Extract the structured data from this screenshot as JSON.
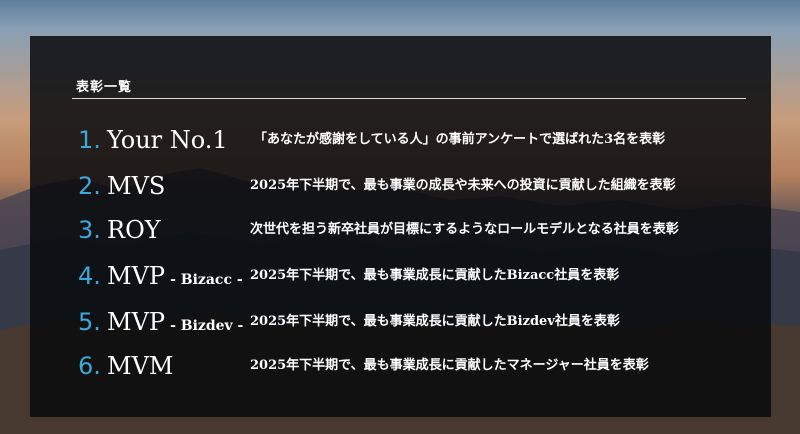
{
  "section": {
    "title": "表彰一覧"
  },
  "awards": [
    {
      "num": "1.",
      "name": "Your No.1",
      "sub": "",
      "desc": "「あなたが感謝をしている人」の事前アンケートで選ばれた3名を表彰"
    },
    {
      "num": "2.",
      "name": "MVS",
      "sub": "",
      "desc": "2025年下半期で、最も事業の成長や未来への投資に貢献した組織を表彰"
    },
    {
      "num": "3.",
      "name": "ROY",
      "sub": "",
      "desc": "次世代を担う新卒社員が目標にするようなロールモデルとなる社員を表彰"
    },
    {
      "num": "4.",
      "name": "MVP",
      "sub": "- Bizacc -",
      "desc": "2025年下半期で、最も事業成長に貢献したBizacc社員を表彰"
    },
    {
      "num": "5.",
      "name": "MVP",
      "sub": "- Bizdev -",
      "desc": "2025年下半期で、最も事業成長に貢献したBizdev社員を表彰"
    },
    {
      "num": "6.",
      "name": "MVM",
      "sub": "",
      "desc": "2025年下半期で、最も事業成長に貢献したマネージャー社員を表彰"
    }
  ],
  "colors": {
    "accent": "#3aa8d8",
    "panel": "#080a0e",
    "text": "#ffffff"
  }
}
